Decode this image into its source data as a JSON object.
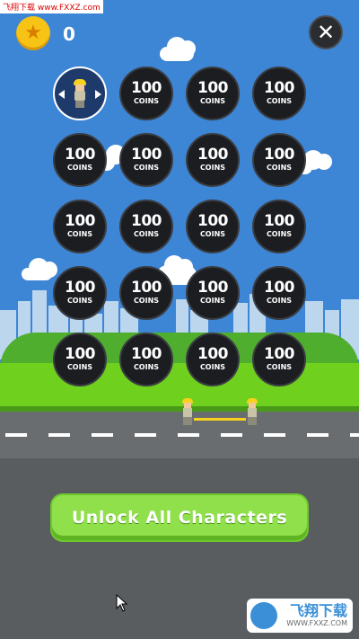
{
  "header": {
    "coin_icon": "star-icon",
    "coin_count": "0",
    "close_icon": "close-icon",
    "close_glyph": "✕"
  },
  "watermark_top": "飞翔下载 www.FXXZ.com",
  "grid": {
    "rows": 5,
    "cols": 4,
    "selected_index": 0,
    "locked_price": "100",
    "locked_unit": "COINS"
  },
  "unlock_button": {
    "label": "Unlock All Characters"
  },
  "watermark_br": {
    "brand": "飞翔下载",
    "url": "WWW.FXXZ.COM"
  },
  "colors": {
    "sky": "#3d86d6",
    "grass": "#6fd11e",
    "road": "#5a5d60",
    "button": "#8fe04a",
    "coin": "#f7c315"
  }
}
